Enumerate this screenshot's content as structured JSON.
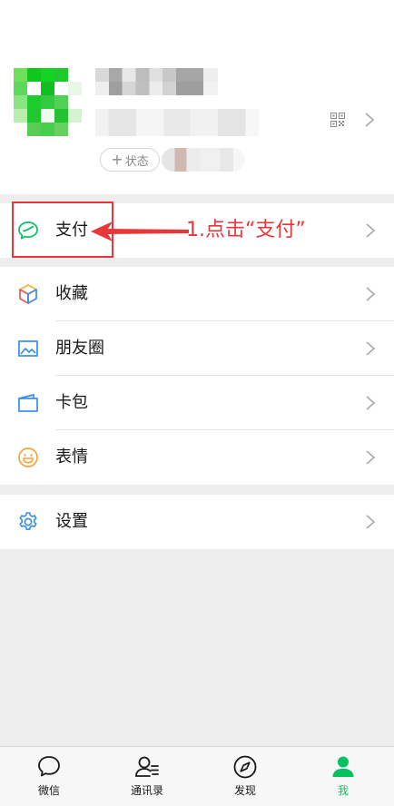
{
  "profile": {
    "status_label": "状态"
  },
  "menu": {
    "pay": "支付",
    "favorites": "收藏",
    "moments": "朋友圈",
    "cards": "卡包",
    "stickers": "表情",
    "settings": "设置"
  },
  "annotation": {
    "text": "1.点击“支付”"
  },
  "tabbar": {
    "chats": "微信",
    "contacts": "通讯录",
    "discover": "发现",
    "me": "我"
  },
  "colors": {
    "brand_green": "#07c160",
    "annotation_red": "#e8373b",
    "favorites_accent": "#f3b43a",
    "moments_accent": "#3a8ee6",
    "stickers_accent": "#f3a33a",
    "settings_accent": "#3a8ee6"
  },
  "icons": {
    "pay": "pay-icon",
    "favorites": "cube-icon",
    "moments": "picture-icon",
    "cards": "wallet-icon",
    "stickers": "smile-icon",
    "settings": "gear-icon",
    "qr": "qr-code-icon",
    "chevron": "chevron-right-icon"
  }
}
